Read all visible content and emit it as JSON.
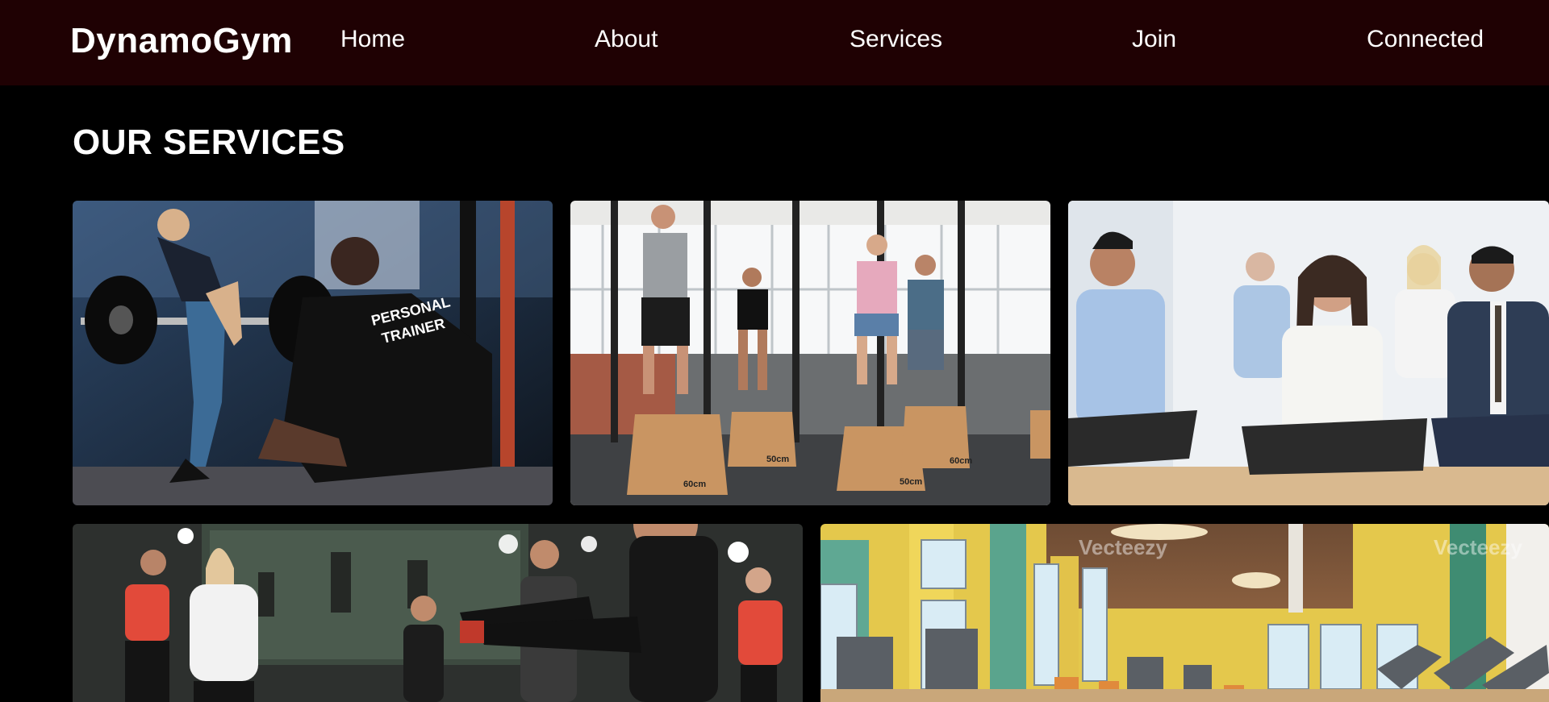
{
  "header": {
    "brand": "DynamoGym",
    "nav": [
      "Home",
      "About",
      "Services",
      "Join",
      "Connected"
    ]
  },
  "services": {
    "title": "OUR SERVICES",
    "cards": [
      {
        "shirt_text_1": "PERSONAL",
        "shirt_text_2": "TRAINER"
      },
      {
        "box_label_1": "60cm",
        "box_label_2": "50cm",
        "box_label_3": "50cm",
        "box_label_4": "60cm"
      },
      {},
      {},
      {
        "watermark": "Vecteezy"
      }
    ]
  },
  "colors": {
    "nav_bg": "#1f0103",
    "page_bg": "#000000",
    "text": "#ffffff"
  }
}
